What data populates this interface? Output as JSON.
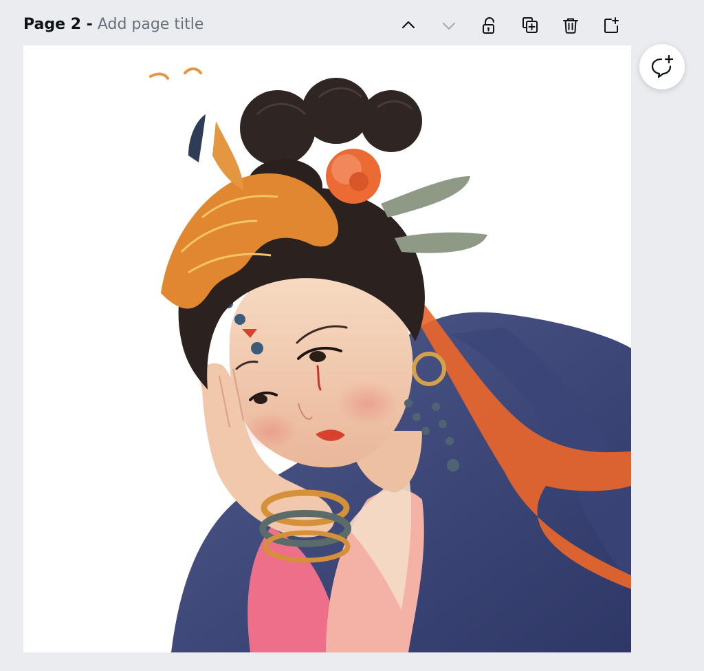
{
  "page_header": {
    "page_label": "Page 2 -",
    "title_placeholder": "Add page title"
  },
  "toolbar": {
    "items": [
      {
        "icon": "chevron-up-icon",
        "label": "Move page up",
        "enabled": true
      },
      {
        "icon": "chevron-down-icon",
        "label": "Move page down",
        "enabled": false
      },
      {
        "icon": "unlock-icon",
        "label": "Lock page",
        "enabled": true
      },
      {
        "icon": "duplicate-icon",
        "label": "Duplicate page",
        "enabled": true
      },
      {
        "icon": "trash-icon",
        "label": "Delete page",
        "enabled": true
      },
      {
        "icon": "add-page-icon",
        "label": "Add page",
        "enabled": true
      }
    ]
  },
  "canvas": {
    "background": "#ffffff",
    "content": "watercolor illustration"
  },
  "comment_button": {
    "icon": "add-comment-icon"
  },
  "colors": {
    "workspace": "#ebecf0",
    "text_primary": "#0d1216",
    "text_secondary": "#66707b",
    "icon_active": "#0d1216",
    "icon_disabled": "#a6abb2"
  }
}
